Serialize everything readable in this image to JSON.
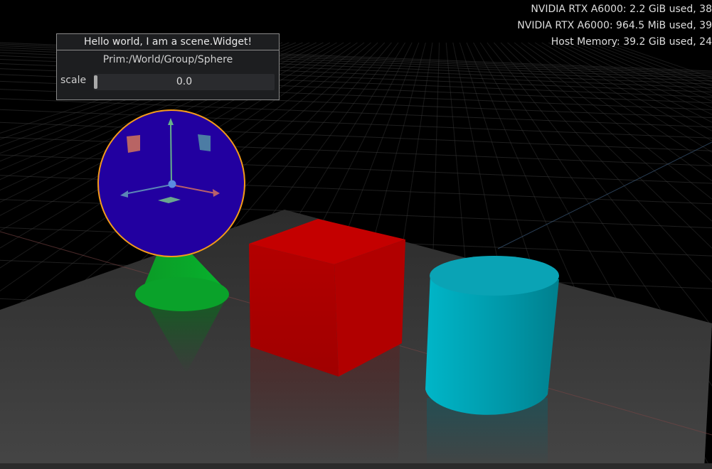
{
  "stats": {
    "gpu1": "NVIDIA RTX A6000: 2.2 GiB used,  38",
    "gpu2": "NVIDIA RTX A6000: 964.5 MiB used,  39",
    "host": "Host Memory: 39.2 GiB used, 24"
  },
  "widget": {
    "title": "Hello world, I am a scene.Widget!",
    "prim": "Prim:/World/Group/Sphere",
    "scale_label": "scale",
    "scale_value": "0.0",
    "scale_level": 0.0
  },
  "colors": {
    "background": "#000000",
    "cube": "#c00000",
    "cylinder": "#00a6b8",
    "cone": "#0aa22a",
    "sphere": "#2200a0",
    "sphere_outline": "#f39a1b",
    "grid": "#3a3a3a",
    "ground": "#3b3b3b"
  }
}
